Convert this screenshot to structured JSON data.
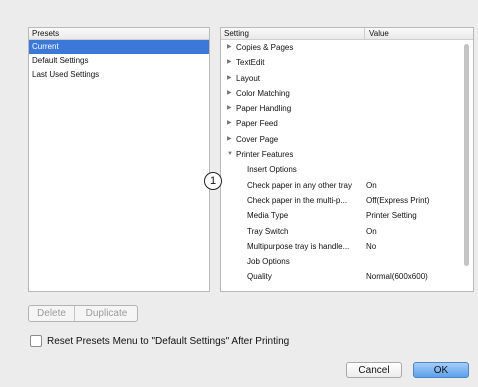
{
  "presets": {
    "header": "Presets",
    "items": [
      "Current",
      "Default Settings",
      "Last Used Settings"
    ],
    "selected_index": 0
  },
  "settings": {
    "col_setting": "Setting",
    "col_value": "Value",
    "rows": [
      {
        "label": "Copies & Pages",
        "value": "",
        "kind": "collapsed"
      },
      {
        "label": "TextEdit",
        "value": "",
        "kind": "collapsed"
      },
      {
        "label": "Layout",
        "value": "",
        "kind": "collapsed"
      },
      {
        "label": "Color Matching",
        "value": "",
        "kind": "collapsed"
      },
      {
        "label": "Paper Handling",
        "value": "",
        "kind": "collapsed"
      },
      {
        "label": "Paper Feed",
        "value": "",
        "kind": "collapsed"
      },
      {
        "label": "Cover Page",
        "value": "",
        "kind": "collapsed"
      },
      {
        "label": "Printer Features",
        "value": "",
        "kind": "expanded"
      },
      {
        "label": "Insert Options",
        "value": "",
        "kind": "child"
      },
      {
        "label": "Check paper in any other tray",
        "value": "On",
        "kind": "child"
      },
      {
        "label": "Check paper in the multi-p...",
        "value": "Off(Express Print)",
        "kind": "child"
      },
      {
        "label": "Media Type",
        "value": "Printer Setting",
        "kind": "child"
      },
      {
        "label": "Tray Switch",
        "value": "On",
        "kind": "child"
      },
      {
        "label": "Multipurpose tray is handle...",
        "value": "No",
        "kind": "child"
      },
      {
        "label": "Job Options",
        "value": "",
        "kind": "child"
      },
      {
        "label": "Quality",
        "value": "Normal(600x600)",
        "kind": "child"
      }
    ]
  },
  "callout": "1",
  "buttons": {
    "delete": "Delete",
    "duplicate": "Duplicate",
    "cancel": "Cancel",
    "ok": "OK"
  },
  "reset_checkbox": {
    "label": "Reset Presets Menu to \"Default Settings\" After Printing",
    "checked": false
  }
}
